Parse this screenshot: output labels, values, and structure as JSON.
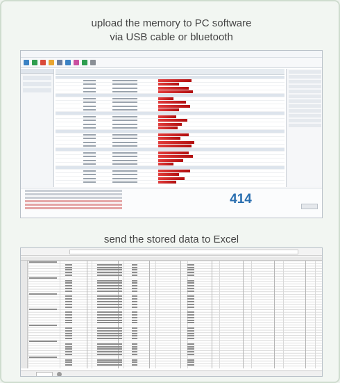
{
  "captions": {
    "upload": "upload the memory to PC software\nvia USB cable or bluetooth",
    "excel": "send the stored data to Excel"
  },
  "software": {
    "measurement_count": "414"
  },
  "colors": {
    "background": "#f2f6f2",
    "accent_blue": "#2a6fb0",
    "bar_red": "#d42a2a"
  }
}
